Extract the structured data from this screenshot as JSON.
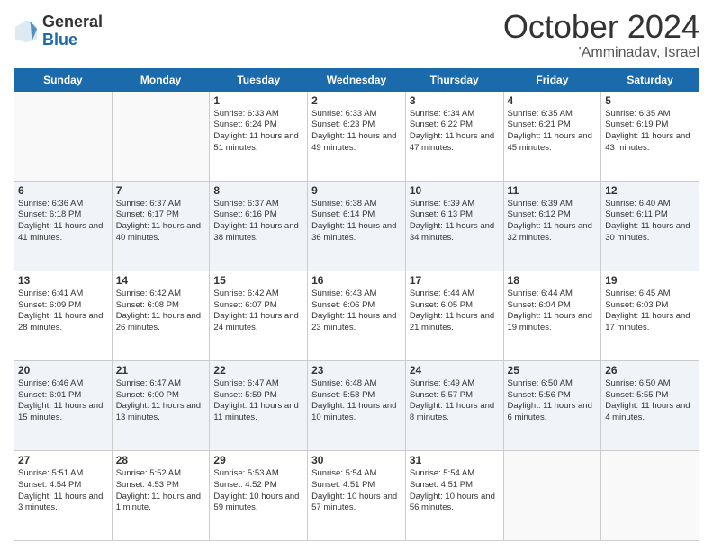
{
  "logo": {
    "general": "General",
    "blue": "Blue"
  },
  "header": {
    "month": "October 2024",
    "location": "'Amminadav, Israel"
  },
  "weekdays": [
    "Sunday",
    "Monday",
    "Tuesday",
    "Wednesday",
    "Thursday",
    "Friday",
    "Saturday"
  ],
  "weeks": [
    [
      {
        "day": "",
        "info": ""
      },
      {
        "day": "",
        "info": ""
      },
      {
        "day": "1",
        "info": "Sunrise: 6:33 AM\nSunset: 6:24 PM\nDaylight: 11 hours and 51 minutes."
      },
      {
        "day": "2",
        "info": "Sunrise: 6:33 AM\nSunset: 6:23 PM\nDaylight: 11 hours and 49 minutes."
      },
      {
        "day": "3",
        "info": "Sunrise: 6:34 AM\nSunset: 6:22 PM\nDaylight: 11 hours and 47 minutes."
      },
      {
        "day": "4",
        "info": "Sunrise: 6:35 AM\nSunset: 6:21 PM\nDaylight: 11 hours and 45 minutes."
      },
      {
        "day": "5",
        "info": "Sunrise: 6:35 AM\nSunset: 6:19 PM\nDaylight: 11 hours and 43 minutes."
      }
    ],
    [
      {
        "day": "6",
        "info": "Sunrise: 6:36 AM\nSunset: 6:18 PM\nDaylight: 11 hours and 41 minutes."
      },
      {
        "day": "7",
        "info": "Sunrise: 6:37 AM\nSunset: 6:17 PM\nDaylight: 11 hours and 40 minutes."
      },
      {
        "day": "8",
        "info": "Sunrise: 6:37 AM\nSunset: 6:16 PM\nDaylight: 11 hours and 38 minutes."
      },
      {
        "day": "9",
        "info": "Sunrise: 6:38 AM\nSunset: 6:14 PM\nDaylight: 11 hours and 36 minutes."
      },
      {
        "day": "10",
        "info": "Sunrise: 6:39 AM\nSunset: 6:13 PM\nDaylight: 11 hours and 34 minutes."
      },
      {
        "day": "11",
        "info": "Sunrise: 6:39 AM\nSunset: 6:12 PM\nDaylight: 11 hours and 32 minutes."
      },
      {
        "day": "12",
        "info": "Sunrise: 6:40 AM\nSunset: 6:11 PM\nDaylight: 11 hours and 30 minutes."
      }
    ],
    [
      {
        "day": "13",
        "info": "Sunrise: 6:41 AM\nSunset: 6:09 PM\nDaylight: 11 hours and 28 minutes."
      },
      {
        "day": "14",
        "info": "Sunrise: 6:42 AM\nSunset: 6:08 PM\nDaylight: 11 hours and 26 minutes."
      },
      {
        "day": "15",
        "info": "Sunrise: 6:42 AM\nSunset: 6:07 PM\nDaylight: 11 hours and 24 minutes."
      },
      {
        "day": "16",
        "info": "Sunrise: 6:43 AM\nSunset: 6:06 PM\nDaylight: 11 hours and 23 minutes."
      },
      {
        "day": "17",
        "info": "Sunrise: 6:44 AM\nSunset: 6:05 PM\nDaylight: 11 hours and 21 minutes."
      },
      {
        "day": "18",
        "info": "Sunrise: 6:44 AM\nSunset: 6:04 PM\nDaylight: 11 hours and 19 minutes."
      },
      {
        "day": "19",
        "info": "Sunrise: 6:45 AM\nSunset: 6:03 PM\nDaylight: 11 hours and 17 minutes."
      }
    ],
    [
      {
        "day": "20",
        "info": "Sunrise: 6:46 AM\nSunset: 6:01 PM\nDaylight: 11 hours and 15 minutes."
      },
      {
        "day": "21",
        "info": "Sunrise: 6:47 AM\nSunset: 6:00 PM\nDaylight: 11 hours and 13 minutes."
      },
      {
        "day": "22",
        "info": "Sunrise: 6:47 AM\nSunset: 5:59 PM\nDaylight: 11 hours and 11 minutes."
      },
      {
        "day": "23",
        "info": "Sunrise: 6:48 AM\nSunset: 5:58 PM\nDaylight: 11 hours and 10 minutes."
      },
      {
        "day": "24",
        "info": "Sunrise: 6:49 AM\nSunset: 5:57 PM\nDaylight: 11 hours and 8 minutes."
      },
      {
        "day": "25",
        "info": "Sunrise: 6:50 AM\nSunset: 5:56 PM\nDaylight: 11 hours and 6 minutes."
      },
      {
        "day": "26",
        "info": "Sunrise: 6:50 AM\nSunset: 5:55 PM\nDaylight: 11 hours and 4 minutes."
      }
    ],
    [
      {
        "day": "27",
        "info": "Sunrise: 5:51 AM\nSunset: 4:54 PM\nDaylight: 11 hours and 3 minutes."
      },
      {
        "day": "28",
        "info": "Sunrise: 5:52 AM\nSunset: 4:53 PM\nDaylight: 11 hours and 1 minute."
      },
      {
        "day": "29",
        "info": "Sunrise: 5:53 AM\nSunset: 4:52 PM\nDaylight: 10 hours and 59 minutes."
      },
      {
        "day": "30",
        "info": "Sunrise: 5:54 AM\nSunset: 4:51 PM\nDaylight: 10 hours and 57 minutes."
      },
      {
        "day": "31",
        "info": "Sunrise: 5:54 AM\nSunset: 4:51 PM\nDaylight: 10 hours and 56 minutes."
      },
      {
        "day": "",
        "info": ""
      },
      {
        "day": "",
        "info": ""
      }
    ]
  ]
}
